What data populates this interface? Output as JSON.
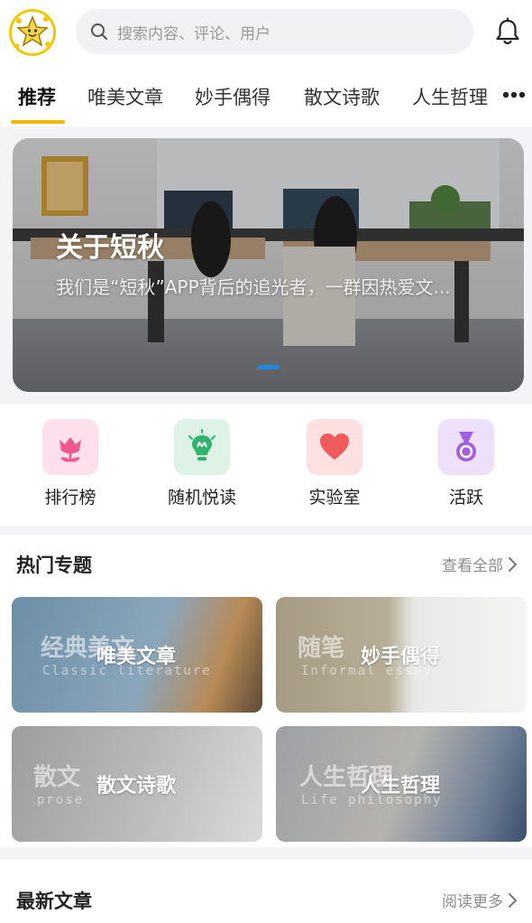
{
  "search": {
    "placeholder": "搜索内容、评论、用户"
  },
  "tabs": [
    {
      "label": "推荐",
      "active": true
    },
    {
      "label": "唯美文章"
    },
    {
      "label": "妙手偶得"
    },
    {
      "label": "散文诗歌"
    },
    {
      "label": "人生哲理"
    }
  ],
  "banner": {
    "title": "关于短秋",
    "subtitle": "我们是“短秋”APP背后的追光者，一群因热爱文..."
  },
  "quick_links": [
    {
      "label": "排行榜",
      "icon": "tulip-icon",
      "color": "#f0588e"
    },
    {
      "label": "随机悦读",
      "icon": "lightbulb-icon",
      "color": "#2fb36f"
    },
    {
      "label": "实验室",
      "icon": "heart-icon",
      "color": "#f05a5a"
    },
    {
      "label": "活跃",
      "icon": "medal-icon",
      "color": "#a35fe0"
    }
  ],
  "hot_topics": {
    "title": "热门专题",
    "more": "查看全部",
    "cards": [
      {
        "label": "唯美文章",
        "ghost": "经典美文",
        "ghost_en": "Classic literature"
      },
      {
        "label": "妙手偶得",
        "ghost": "随笔",
        "ghost_en": "Informal essay"
      },
      {
        "label": "散文诗歌",
        "ghost": "散文",
        "ghost_en": "prose"
      },
      {
        "label": "人生哲理",
        "ghost": "人生哲理",
        "ghost_en": "Life philosophy"
      }
    ]
  },
  "latest": {
    "title": "最新文章",
    "more": "阅读更多"
  },
  "colors": {
    "accent": "#f4b800",
    "indicator": "#1e88e5"
  }
}
